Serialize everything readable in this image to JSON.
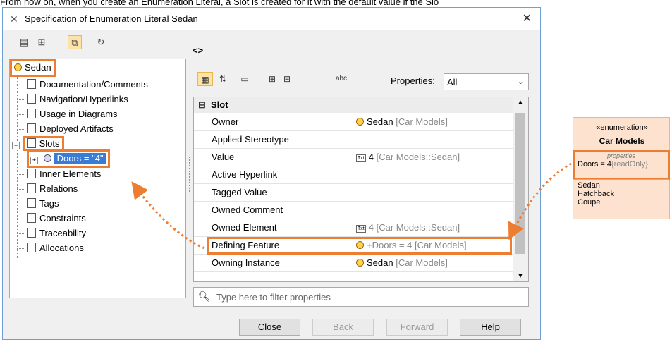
{
  "caption": "From now on, when you create an Enumeration Literal, a Slot is created for it with the default value if the Slo",
  "dialog": {
    "title": "Specification of Enumeration Literal Sedan",
    "code_label": "<>"
  },
  "tree": {
    "root": "Sedan",
    "items": [
      "Documentation/Comments",
      "Navigation/Hyperlinks",
      "Usage in Diagrams",
      "Deployed Artifacts",
      "Slots",
      "Doors = \"4\"",
      "Inner Elements",
      "Relations",
      "Tags",
      "Constraints",
      "Traceability",
      "Allocations"
    ]
  },
  "properties": {
    "filter_label": "Properties:",
    "filter_value": "All",
    "group": "Slot",
    "rows": [
      {
        "name": "Owner",
        "value": "Sedan",
        "context": "[Car Models]"
      },
      {
        "name": "Applied Stereotype",
        "value": "",
        "context": ""
      },
      {
        "name": "Value",
        "value": "4",
        "context": "[Car Models::Sedan]"
      },
      {
        "name": "Active Hyperlink",
        "value": "",
        "context": ""
      },
      {
        "name": "Tagged Value",
        "value": "",
        "context": ""
      },
      {
        "name": "Owned Comment",
        "value": "",
        "context": ""
      },
      {
        "name": "Owned Element",
        "value": "4",
        "context": "[Car Models::Sedan]"
      },
      {
        "name": "Defining Feature",
        "value": "+Doors = 4",
        "context": "[Car Models]"
      },
      {
        "name": "Owning Instance",
        "value": "Sedan",
        "context": "[Car Models]"
      }
    ],
    "search_placeholder": "Type here to filter properties"
  },
  "buttons": {
    "close": "Close",
    "back": "Back",
    "forward": "Forward",
    "help": "Help"
  },
  "uml": {
    "stereotype": "«enumeration»",
    "name": "Car Models",
    "compartment_title": "properties",
    "property": "Doors = 4",
    "property_modifier": "{readOnly}",
    "literals": [
      "Sedan",
      "Hatchback",
      "Coupe"
    ]
  },
  "colors": {
    "highlight": "#ed7d31",
    "selection": "#3a7bd5",
    "uml_fill": "#fde2cf"
  }
}
